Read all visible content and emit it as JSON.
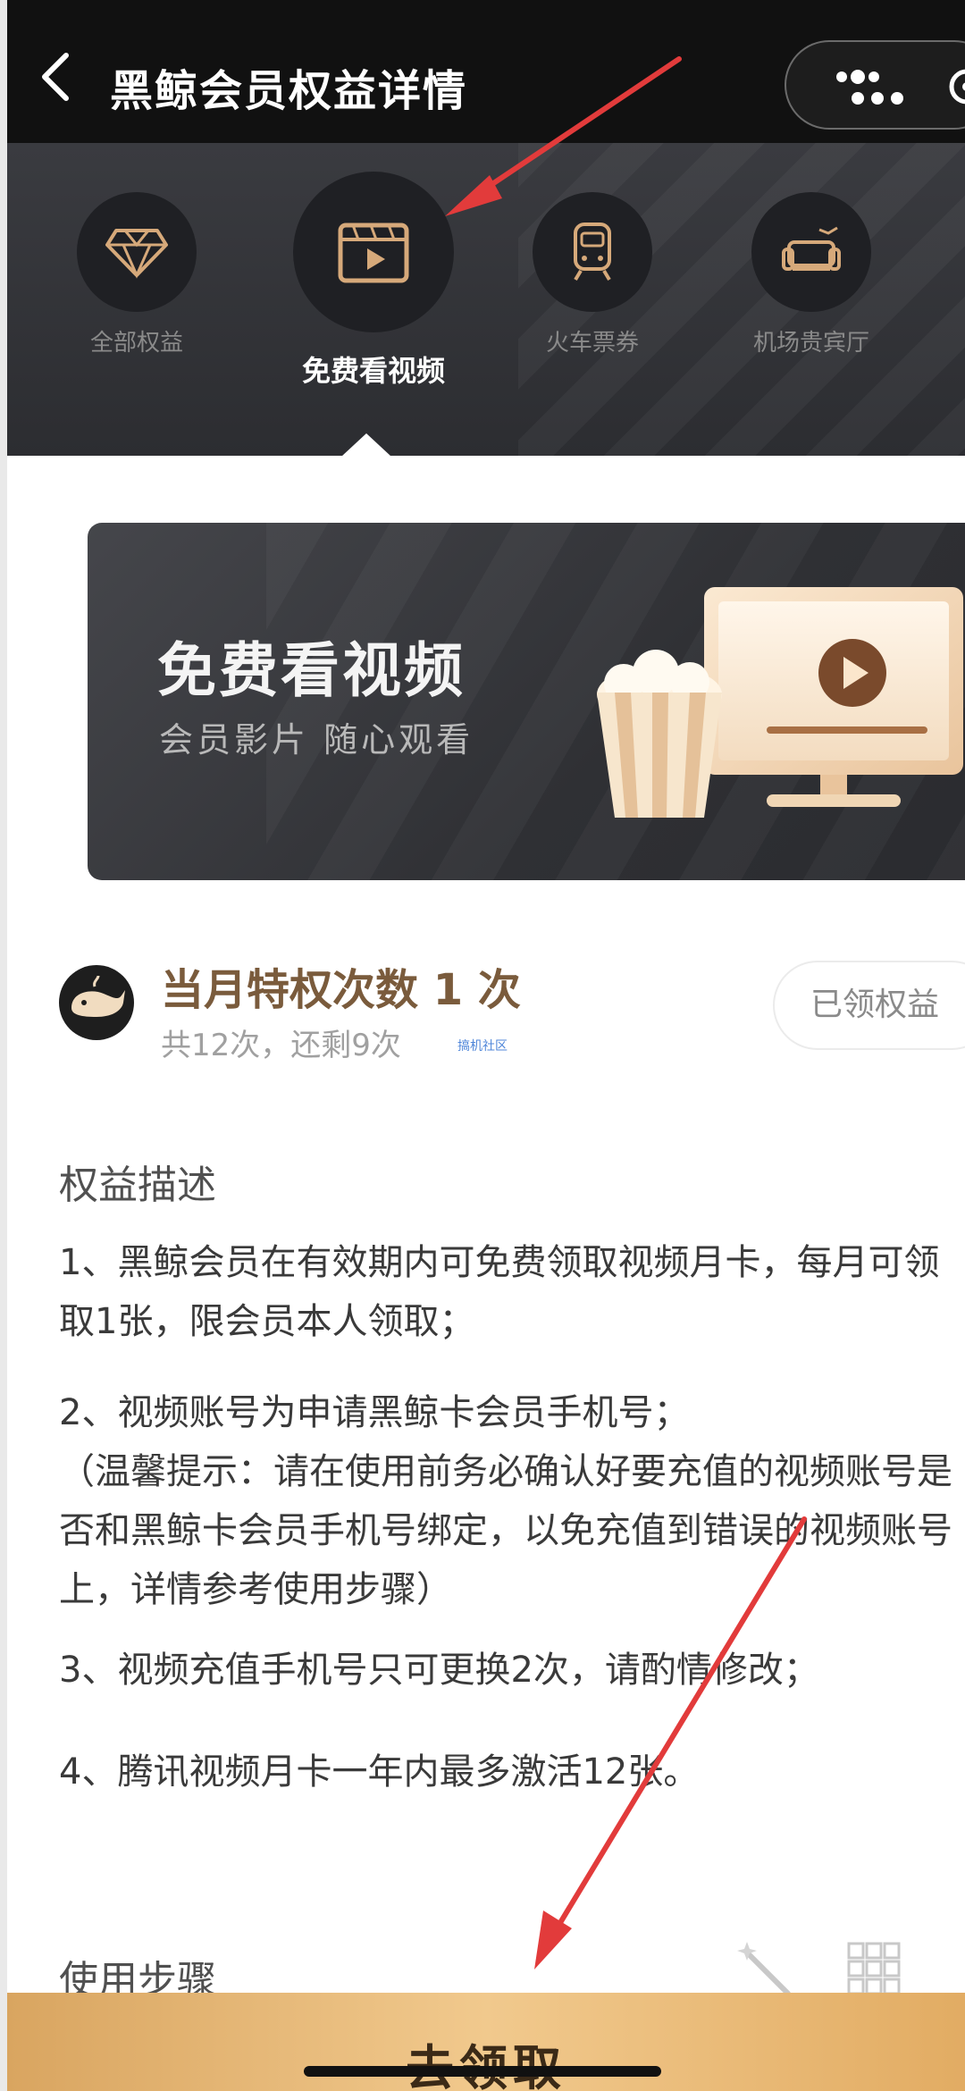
{
  "header": {
    "title": "黑鲸会员权益详情"
  },
  "tabs": [
    {
      "label": "全部权益",
      "icon": "diamond-icon",
      "active": false
    },
    {
      "label": "免费看视频",
      "icon": "video-icon",
      "active": true
    },
    {
      "label": "火车票券",
      "icon": "train-icon",
      "active": false
    },
    {
      "label": "机场贵宾厅",
      "icon": "lounge-sofa-icon",
      "active": false
    }
  ],
  "banner": {
    "title": "免费看视频",
    "subtitle": "会员影片  随心观看"
  },
  "quota": {
    "title": "当月特权次数 1 次",
    "subtitle": "共12次，还剩9次",
    "watermark": "搞机社区",
    "claimed_button": "已领权益"
  },
  "description": {
    "title": "权益描述",
    "items": [
      {
        "line1": "1、黑鲸会员在有效期内可免费领取视频月卡，每月可领",
        "line2": "取1张，限会员本人领取；"
      },
      {
        "line1": "2、视频账号为申请黑鲸卡会员手机号；",
        "line2": "（温馨提示：请在使用前务必确认好要充值的视频账号是",
        "line3": "否和黑鲸卡会员手机号绑定，以免充值到错误的视频账号",
        "line4": "上，详情参考使用步骤）"
      },
      {
        "line1": "3、视频充值手机号只可更换2次，请酌情修改；"
      },
      {
        "line1": "4、腾讯视频月卡一年内最多激活12张。"
      }
    ]
  },
  "steps": {
    "title": "使用步骤"
  },
  "cta": {
    "label": "去领取"
  },
  "colors": {
    "accent_gold": "#e2ac63",
    "quota_brown": "#7a5b3c",
    "annotation_red": "#e23b3b"
  }
}
